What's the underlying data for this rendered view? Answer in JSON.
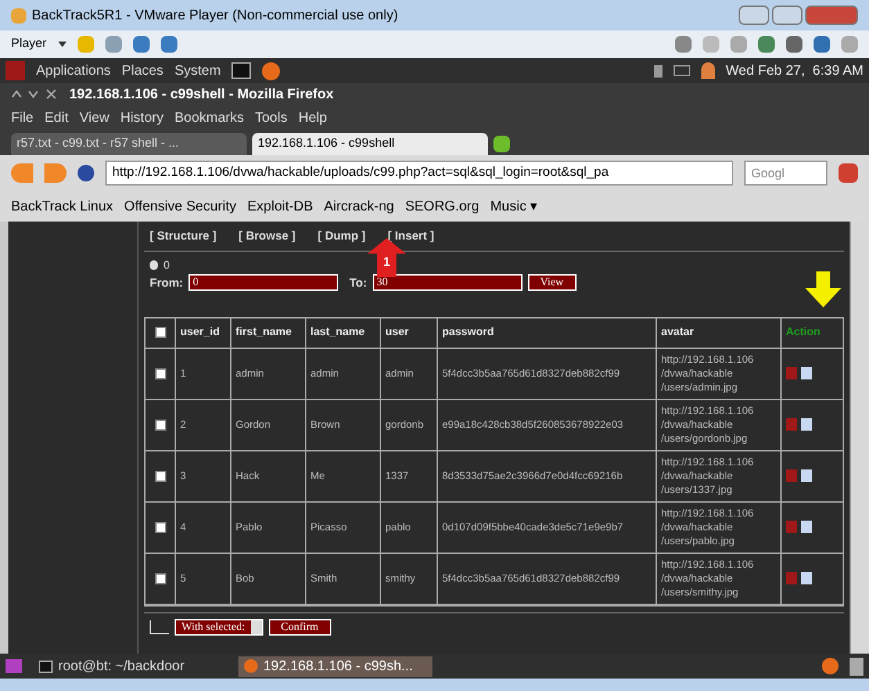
{
  "vm_window": {
    "title": "BackTrack5R1 - VMware Player (Non-commercial use only)",
    "player_menu": "Player"
  },
  "gnome_panel": {
    "menus": [
      "Applications",
      "Places",
      "System"
    ],
    "clock": "Wed Feb 27,  6:39 AM"
  },
  "firefox": {
    "title": "192.168.1.106 - c99shell - Mozilla Firefox",
    "menu": [
      "File",
      "Edit",
      "View",
      "History",
      "Bookmarks",
      "Tools",
      "Help"
    ],
    "tabs": [
      {
        "label": "r57.txt - c99.txt - r57 shell - ...",
        "selected": false
      },
      {
        "label": "192.168.1.106 - c99shell",
        "selected": true
      }
    ],
    "url": "http://192.168.1.106/dvwa/hackable/uploads/c99.php?act=sql&sql_login=root&sql_pa",
    "search_placeholder": "Googl",
    "bookmarks": [
      "BackTrack Linux",
      "Offensive Security",
      "Exploit-DB",
      "Aircrack-ng",
      "SEORG.org",
      "Music ▾"
    ]
  },
  "page": {
    "links": [
      "[ Structure ]",
      "[ Browse ]",
      "[ Dump ]",
      "[ Insert ]"
    ],
    "count": "0",
    "from_label": "From:",
    "from_value": "0",
    "to_label": "To:",
    "to_value": "30",
    "view_button": "View",
    "table": {
      "select_all_checked": false,
      "columns": [
        "user_id",
        "first_name",
        "last_name",
        "user",
        "password",
        "avatar",
        "Action"
      ],
      "rows": [
        {
          "checked": false,
          "cells": [
            "1",
            "admin",
            "admin",
            "admin",
            "5f4dcc3b5aa765d61d8327deb882cf99",
            "http://192.168.1.106 /dvwa/hackable /users/admin.jpg"
          ]
        },
        {
          "checked": false,
          "cells": [
            "2",
            "Gordon",
            "Brown",
            "gordonb",
            "e99a18c428cb38d5f260853678922e03",
            "http://192.168.1.106 /dvwa/hackable /users/gordonb.jpg"
          ]
        },
        {
          "checked": false,
          "cells": [
            "3",
            "Hack",
            "Me",
            "1337",
            "8d3533d75ae2c3966d7e0d4fcc69216b",
            "http://192.168.1.106 /dvwa/hackable /users/1337.jpg"
          ]
        },
        {
          "checked": false,
          "cells": [
            "4",
            "Pablo",
            "Picasso",
            "pablo",
            "0d107d09f5bbe40cade3de5c71e9e9b7",
            "http://192.168.1.106 /dvwa/hackable /users/pablo.jpg"
          ]
        },
        {
          "checked": false,
          "cells": [
            "5",
            "Bob",
            "Smith",
            "smithy",
            "5f4dcc3b5aa765d61d8327deb882cf99",
            "http://192.168.1.106 /dvwa/hackable /users/smithy.jpg"
          ]
        }
      ]
    },
    "with_selected": "With selected:",
    "confirm_button": "Confirm"
  },
  "annotation": {
    "step": "1"
  },
  "taskbar": [
    {
      "label": "root@bt: ~/backdoor",
      "kind": "terminal",
      "selected": false
    },
    {
      "label": "192.168.1.106 - c99sh...",
      "kind": "browser",
      "selected": true
    }
  ]
}
